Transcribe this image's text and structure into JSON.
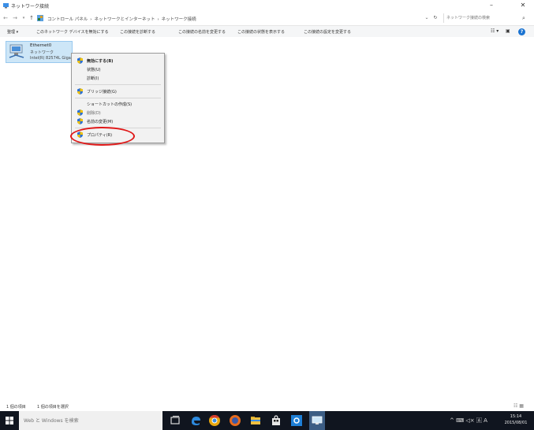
{
  "window": {
    "title": "ネットワーク接続",
    "minimize_glyph": "–",
    "close_glyph": "✕"
  },
  "nav": {
    "back_glyph": "←",
    "forward_glyph": "→",
    "recent_glyph": "▾",
    "up_glyph": "↑",
    "breadcrumbs": [
      "コントロール パネル",
      "›",
      "ネットワークとインターネット",
      "›",
      "ネットワーク接続"
    ],
    "dropdown_glyph": "⌄",
    "refresh_glyph": "↻",
    "search_placeholder": "ネットワーク接続の検索",
    "search_glyph": "⌕"
  },
  "commands": {
    "organize": "整理 ▾",
    "items": [
      "このネットワーク デバイスを無効にする",
      "この接続を診断する",
      "この接続の名前を変更する",
      "この接続の状態を表示する",
      "この接続の設定を変更する"
    ],
    "view_glyph": "☷ ▾",
    "pane_glyph": "▣",
    "help_glyph": "?"
  },
  "adapter": {
    "name": "Ethernet0",
    "status": "ネットワーク",
    "device": "Intel(R) 82574L Gigabit..."
  },
  "context_menu": {
    "items": [
      {
        "label": "無効にする(B)",
        "shield": true,
        "bold": true
      },
      {
        "label": "状態(U)",
        "shield": false
      },
      {
        "label": "診断(I)",
        "shield": false
      },
      {
        "label": "ブリッジ接続(G)",
        "shield": true
      },
      {
        "label": "ショートカットの作成(S)",
        "shield": false
      },
      {
        "label": "削除(D)",
        "shield": true,
        "dim": true
      },
      {
        "label": "名前の変更(M)",
        "shield": true
      },
      {
        "label": "プロパティ(R)",
        "shield": true
      }
    ]
  },
  "status": {
    "item_count": "1 個の項目",
    "selected": "1 個の項目を選択",
    "view_glyph": "☷ ▦"
  },
  "taskbar": {
    "search_placeholder": "Web と Windows を検索",
    "tray": "^ ⌨ ◁× 🄰 A",
    "time": "15:14",
    "date": "2015/08/01"
  },
  "colors": {
    "accent": "#1a73d1",
    "selection_bg": "#cde6f7",
    "highlight_ring": "#e01818",
    "taskbar_bg": "#10151f",
    "shield_blue": "#2a6fd6",
    "shield_yellow": "#f2c200"
  }
}
